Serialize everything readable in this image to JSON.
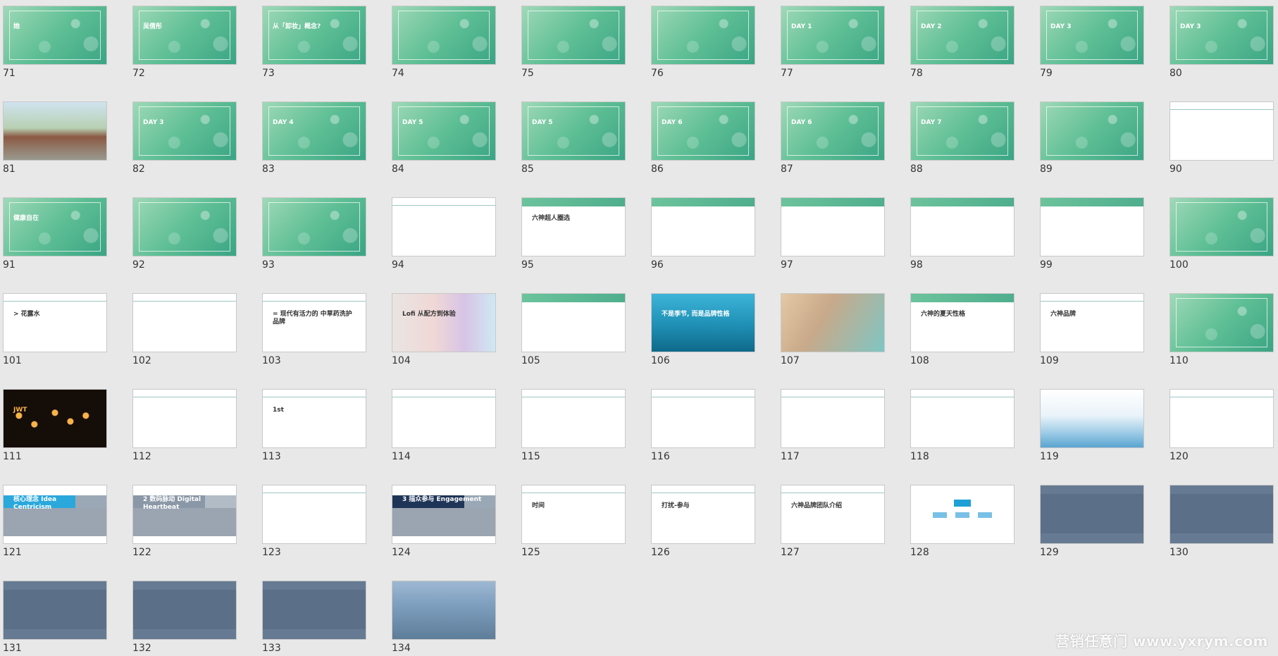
{
  "slides": [
    {
      "number": "71",
      "theme": "green",
      "caption": "她"
    },
    {
      "number": "72",
      "theme": "green",
      "caption": "吴倩彤"
    },
    {
      "number": "73",
      "theme": "green",
      "caption": "从「卸妆」概念?"
    },
    {
      "number": "74",
      "theme": "green",
      "caption": ""
    },
    {
      "number": "75",
      "theme": "green",
      "caption": ""
    },
    {
      "number": "76",
      "theme": "green",
      "caption": ""
    },
    {
      "number": "77",
      "theme": "green",
      "caption": "DAY 1"
    },
    {
      "number": "78",
      "theme": "green",
      "caption": "DAY 2"
    },
    {
      "number": "79",
      "theme": "green",
      "caption": "DAY 3"
    },
    {
      "number": "80",
      "theme": "green",
      "caption": "DAY 3"
    },
    {
      "number": "81",
      "theme": "photo-street",
      "caption": ""
    },
    {
      "number": "82",
      "theme": "green",
      "caption": "DAY 3"
    },
    {
      "number": "83",
      "theme": "green",
      "caption": "DAY 4"
    },
    {
      "number": "84",
      "theme": "green",
      "caption": "DAY 5"
    },
    {
      "number": "85",
      "theme": "green",
      "caption": "DAY 5"
    },
    {
      "number": "86",
      "theme": "green",
      "caption": "DAY 6"
    },
    {
      "number": "87",
      "theme": "green",
      "caption": "DAY 6"
    },
    {
      "number": "88",
      "theme": "green",
      "caption": "DAY 7"
    },
    {
      "number": "89",
      "theme": "green",
      "caption": ""
    },
    {
      "number": "90",
      "theme": "white",
      "caption": ""
    },
    {
      "number": "91",
      "theme": "green",
      "caption": "健康自在"
    },
    {
      "number": "92",
      "theme": "green",
      "caption": ""
    },
    {
      "number": "93",
      "theme": "green",
      "caption": ""
    },
    {
      "number": "94",
      "theme": "white",
      "caption": ""
    },
    {
      "number": "95",
      "theme": "greenhead",
      "caption": "六神超人圈选"
    },
    {
      "number": "96",
      "theme": "greenhead",
      "caption": ""
    },
    {
      "number": "97",
      "theme": "greenhead",
      "caption": ""
    },
    {
      "number": "98",
      "theme": "greenhead",
      "caption": ""
    },
    {
      "number": "99",
      "theme": "greenhead",
      "caption": ""
    },
    {
      "number": "100",
      "theme": "green",
      "caption": ""
    },
    {
      "number": "101",
      "theme": "white",
      "caption": "> 花露水"
    },
    {
      "number": "102",
      "theme": "white",
      "caption": ""
    },
    {
      "number": "103",
      "theme": "white",
      "caption": "= 现代有活力的 中草药洗护品牌"
    },
    {
      "number": "104",
      "theme": "colorful",
      "caption": "Lofi 从配方到体验"
    },
    {
      "number": "105",
      "theme": "greenhead",
      "caption": ""
    },
    {
      "number": "106",
      "theme": "photo-beach",
      "caption": "不是季节, 而是品牌性格"
    },
    {
      "number": "107",
      "theme": "photo-beach2",
      "caption": ""
    },
    {
      "number": "108",
      "theme": "greenhead",
      "caption": "六神的夏天性格"
    },
    {
      "number": "109",
      "theme": "white",
      "caption": "六神品牌"
    },
    {
      "number": "110",
      "theme": "green",
      "caption": ""
    },
    {
      "number": "111",
      "theme": "dark",
      "caption": "JWT"
    },
    {
      "number": "112",
      "theme": "white",
      "caption": ""
    },
    {
      "number": "113",
      "theme": "white",
      "caption": "1st"
    },
    {
      "number": "114",
      "theme": "white",
      "caption": ""
    },
    {
      "number": "115",
      "theme": "white",
      "caption": ""
    },
    {
      "number": "116",
      "theme": "white",
      "caption": ""
    },
    {
      "number": "117",
      "theme": "white",
      "caption": ""
    },
    {
      "number": "118",
      "theme": "white",
      "caption": ""
    },
    {
      "number": "119",
      "theme": "water",
      "caption": ""
    },
    {
      "number": "120",
      "theme": "white",
      "caption": ""
    },
    {
      "number": "121",
      "theme": "bluehead",
      "caption": "核心理念 Idea Centricism"
    },
    {
      "number": "122",
      "theme": "grayhead",
      "caption": "2 数码脉动 Digital Heartbeat"
    },
    {
      "number": "123",
      "theme": "white",
      "caption": ""
    },
    {
      "number": "124",
      "theme": "navyhead",
      "caption": "3 描众参与 Engagement"
    },
    {
      "number": "125",
      "theme": "white",
      "caption": "时间"
    },
    {
      "number": "126",
      "theme": "white",
      "caption": "打扰-参与"
    },
    {
      "number": "127",
      "theme": "white",
      "caption": "六神品牌团队介绍"
    },
    {
      "number": "128",
      "theme": "team",
      "caption": ""
    },
    {
      "number": "129",
      "theme": "slate",
      "caption": ""
    },
    {
      "number": "130",
      "theme": "slate",
      "caption": ""
    },
    {
      "number": "131",
      "theme": "slate",
      "caption": ""
    },
    {
      "number": "132",
      "theme": "slate",
      "caption": ""
    },
    {
      "number": "133",
      "theme": "slate",
      "caption": ""
    },
    {
      "number": "134",
      "theme": "city",
      "caption": ""
    }
  ],
  "watermark": "营销任意门 www.yxrym.com"
}
